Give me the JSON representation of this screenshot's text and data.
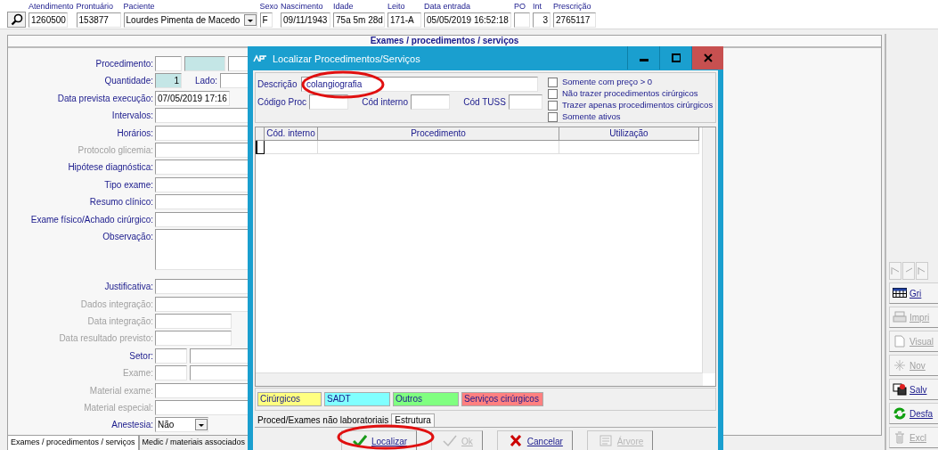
{
  "header": {
    "fields": [
      {
        "label": "Atendimento",
        "value": "1260500",
        "kind": "text"
      },
      {
        "label": "Prontuário",
        "value": "153877",
        "kind": "text"
      },
      {
        "label": "Paciente",
        "value": "Lourdes Pimenta de Macedo",
        "kind": "dropdown"
      },
      {
        "label": "Sexo",
        "value": "F",
        "kind": "text"
      },
      {
        "label": "Nascimento",
        "value": "09/11/1943",
        "kind": "text"
      },
      {
        "label": "Idade",
        "value": "75a 5m 28d",
        "kind": "text"
      },
      {
        "label": "Leito",
        "value": "171-A",
        "kind": "text"
      },
      {
        "label": "Data entrada",
        "value": "05/05/2019 16:52:18",
        "kind": "text"
      },
      {
        "label": "PO",
        "kind": "text"
      },
      {
        "label": "Int",
        "value": "3",
        "kind": "number"
      },
      {
        "label": "Prescrição",
        "value": "2765117",
        "kind": "text"
      }
    ]
  },
  "panel_title": "Exames / procedimentos / serviços",
  "form": {
    "rows": [
      {
        "label": "Procedimento:",
        "kind": "triple",
        "disabled": false
      },
      {
        "label": "Quantidade:",
        "kind": "quantity",
        "value": "1",
        "side_label": "Lado:",
        "disabled": false
      },
      {
        "label": "Data prevista execução:",
        "kind": "date",
        "value": "07/05/2019 17:16",
        "disabled": false
      },
      {
        "label": "Intervalos:",
        "kind": "text",
        "disabled": false
      },
      {
        "label": "Horários:",
        "kind": "text",
        "disabled": false
      },
      {
        "label": "Protocolo glicemia:",
        "kind": "text",
        "disabled": true
      },
      {
        "label": "Hipótese diagnóstica:",
        "kind": "text",
        "disabled": false
      },
      {
        "label": "Tipo exame:",
        "kind": "text",
        "disabled": false
      },
      {
        "label": "Resumo clínico:",
        "kind": "text",
        "disabled": false
      },
      {
        "label": "Exame físico/Achado cirúrgico:",
        "kind": "text",
        "disabled": false
      },
      {
        "label": "Observação:",
        "kind": "memo",
        "disabled": false
      },
      {
        "label": "Justificativa:",
        "kind": "text",
        "disabled": false
      },
      {
        "label": "Dados integração:",
        "kind": "text",
        "disabled": true
      },
      {
        "label": "Data integração:",
        "kind": "short",
        "disabled": true
      },
      {
        "label": "Data resultado previsto:",
        "kind": "short",
        "disabled": true
      },
      {
        "label": "Setor:",
        "kind": "pair",
        "disabled": false
      },
      {
        "label": "Exame:",
        "kind": "pair",
        "disabled": true
      },
      {
        "label": "Material exame:",
        "kind": "text",
        "disabled": true
      },
      {
        "label": "Material especial:",
        "kind": "text",
        "disabled": true
      },
      {
        "label": "Anestesia:",
        "kind": "select",
        "value": "Não",
        "disabled": false
      }
    ]
  },
  "bottom_tabs": [
    {
      "label": "Exames / procedimentos / serviços",
      "selected": true
    },
    {
      "label": "Medic / materiais associados",
      "selected": false
    }
  ],
  "toolbar": {
    "buttons": [
      {
        "label": "Gri",
        "disabled": false
      },
      {
        "label": "Impri",
        "disabled": true
      },
      {
        "label": "Visual",
        "disabled": true
      },
      {
        "label": "Nov",
        "disabled": true
      },
      {
        "label": "Salv",
        "disabled": false
      },
      {
        "label": "Desfa",
        "disabled": false
      },
      {
        "label": "Excl",
        "disabled": true
      }
    ]
  },
  "dialog": {
    "title": "Localizar Procedimentos/Serviços",
    "description": {
      "label": "Descrição",
      "value": "colangiografia"
    },
    "code_fields": [
      {
        "label": "Código Proc"
      },
      {
        "label": "Cód interno"
      },
      {
        "label": "Cód TUSS"
      }
    ],
    "options": [
      {
        "label": "Somente com preço > 0",
        "checked": false
      },
      {
        "label": "Não trazer procedimentos cirúrgicos",
        "checked": false
      },
      {
        "label": "Trazer apenas procedimentos cirúrgicos",
        "checked": false
      },
      {
        "label": "Somente ativos",
        "checked": false
      }
    ],
    "table": {
      "columns": [
        "Cód. interno",
        "Procedimento",
        "Utilização"
      ]
    },
    "legend": [
      {
        "label": "Cirúrgicos",
        "color": "#ffff80"
      },
      {
        "label": "SADT",
        "color": "#80ffff"
      },
      {
        "label": "Outros",
        "color": "#80ff80"
      },
      {
        "label": "Serviços cirúrgicos",
        "color": "#ff8080"
      }
    ],
    "tabs": [
      {
        "label": "Proced/Exames não laboratoriais",
        "selected": true
      },
      {
        "label": "Estrutura",
        "selected": false
      }
    ],
    "buttons": [
      {
        "label": "Localizar",
        "disabled": false
      },
      {
        "label": "Ok",
        "disabled": true
      },
      {
        "label": "Cancelar",
        "disabled": false
      },
      {
        "label": "Árvore",
        "disabled": true
      }
    ]
  }
}
